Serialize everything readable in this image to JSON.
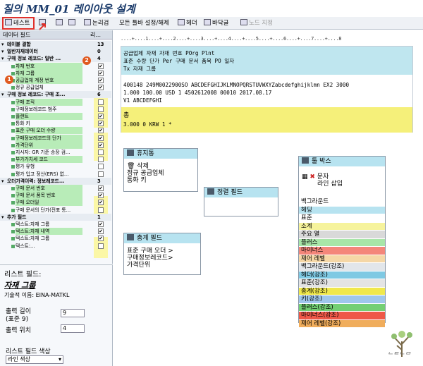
{
  "title": "질의 MM_01 레이아웃 설계",
  "toolbar": {
    "test": "테스트",
    "checks": "논리검",
    "toggle_all": "모든 툴바 설정/해제",
    "header": "헤더",
    "footer": "바닥글",
    "node_spec": "노드 지정"
  },
  "left": {
    "header": {
      "col1": "데이터 필드",
      "col2": "리..."
    },
    "rows": [
      {
        "label": "테이블 결합",
        "count": "13",
        "kind": "sec"
      },
      {
        "label": "일반자재데이터",
        "count": "0",
        "kind": "sec"
      },
      {
        "label": "구매 정보 레코드: 일반 ...",
        "count": "4",
        "kind": "sec"
      },
      {
        "label": "자재 번호",
        "kind": "g",
        "checked": true
      },
      {
        "label": "자재 그룹",
        "kind": "g",
        "checked": true
      },
      {
        "label": "공급업체 계정 번호",
        "kind": "g",
        "checked": true
      },
      {
        "label": "정규 공급업체",
        "kind": "n",
        "checked": true
      },
      {
        "label": "구매 정보 레코드: 구매 조...",
        "count": "6",
        "kind": "sec"
      },
      {
        "label": "구매 조직",
        "kind": "g",
        "checked": false
      },
      {
        "label": "구매정보레코드 범주",
        "kind": "n",
        "checked": false
      },
      {
        "label": "플랜트",
        "kind": "g",
        "checked": true
      },
      {
        "label": "통화 키",
        "kind": "n",
        "checked": true
      },
      {
        "label": "표준 구매 오더 수량",
        "kind": "g",
        "checked": true
      },
      {
        "label": "구매정보레코드의 단가",
        "kind": "g",
        "checked": true
      },
      {
        "label": "가격단위",
        "kind": "g",
        "checked": true
      },
      {
        "label": "지시자: GR 기준 송장 검...",
        "kind": "n",
        "checked": false
      },
      {
        "label": "부가가치세 코드",
        "kind": "g",
        "checked": false
      },
      {
        "label": "평가 유형",
        "kind": "n",
        "checked": false
      },
      {
        "label": "평가 입고 정산(ERS) 없...",
        "kind": "n",
        "checked": false
      },
      {
        "label": "오더가격이력: 정보레코드...",
        "count": "3",
        "kind": "sec"
      },
      {
        "label": "구매 문서 번호",
        "kind": "g",
        "checked": true
      },
      {
        "label": "구매 문서 품목 번호",
        "kind": "g",
        "checked": true
      },
      {
        "label": "구매 오더일",
        "kind": "g",
        "checked": true
      },
      {
        "label": "구매 문서의 단가(전표 통...",
        "kind": "n",
        "checked": false
      },
      {
        "label": "추가 필드",
        "count": "1",
        "kind": "sec"
      },
      {
        "label": "텍스트:자재 그룹",
        "kind": "n",
        "checked": true
      },
      {
        "label": "텍스트:자재 내역",
        "kind": "g",
        "checked": true
      },
      {
        "label": "텍스트:자재 그룹",
        "kind": "n",
        "checked": true
      },
      {
        "label": "텍스트:...",
        "kind": "n",
        "checked": false
      }
    ],
    "badge1": "1",
    "badge2": "2"
  },
  "props": {
    "heading": "리스트 필드:",
    "field_title": "자재 그룹",
    "tech_name": "기술적 이름: EINA-MATKL",
    "out_len_label": "출력 길이",
    "out_len_sub": "(표준 9)",
    "out_len_value": "9",
    "out_pos_label": "출력 위치",
    "out_pos_value": "4",
    "color_label": "리스트 필드 색상",
    "color_value": "라인 색상"
  },
  "ruler": "....+....1....+....2....+....3....+....4....+....5....+....6....+....7....+....8",
  "list": {
    "h1": "공급업체    자재              자재 번호                                POrg Plnt",
    "h2": "표준 수량              단가                  Per    구매 문서  품목  PO 일자",
    "h3": "Tx 자재 그룹",
    "r1": "400148      249M0022900SO      ABCDEFGHIJKLMNOPQRSTUVWXYZabcdefghijklmn EX2  3000",
    "r2": "           1.000              100.00  USD     1  4502612008 00010 2017.08.17",
    "r3": "V1 ABCDEFGHI",
    "total_label": "총",
    "t1": "           3.000                   0  KRW     1  *"
  },
  "boxes": {
    "break": {
      "title": "휴지통",
      "items": [
        "삭제",
        "정규 공급업체",
        "통화 키"
      ]
    },
    "sort": {
      "title": "정렬 필드"
    },
    "total": {
      "title": "총계 필드",
      "items": [
        "표준 구매 오더 >",
        "구매정보레코드>",
        "가격단위"
      ]
    },
    "tool": {
      "title": "툴 박스",
      "items": [
        "문자",
        "라인 삽입"
      ]
    }
  },
  "colors": {
    "title": "백그라운드",
    "list": [
      {
        "label": "헤딩",
        "color": "#b7e3f0"
      },
      {
        "label": "표준",
        "color": "#ffffff"
      },
      {
        "label": "소계",
        "color": "#f6f39c"
      },
      {
        "label": "주요 열",
        "color": "#d9d9d9"
      },
      {
        "label": "플러스",
        "color": "#a8e6a8"
      },
      {
        "label": "마이너스",
        "color": "#f4867a"
      },
      {
        "label": "제어 레벨",
        "color": "#f5d7a6"
      },
      {
        "label": "백그라운드(강조)",
        "color": "#e2e6ea"
      },
      {
        "label": "헤더(강조)",
        "color": "#7fc9e3"
      },
      {
        "label": "표준(강조)",
        "color": "#e4e4e4"
      },
      {
        "label": "총계(강조)",
        "color": "#f0e84c"
      },
      {
        "label": "키(강조)",
        "color": "#9fc7ec"
      },
      {
        "label": "플러스(강조)",
        "color": "#73cf73"
      },
      {
        "label": "마이너스(강조)",
        "color": "#ef5848"
      },
      {
        "label": "제어 레벨(강조)",
        "color": "#f0ad5c"
      }
    ]
  }
}
